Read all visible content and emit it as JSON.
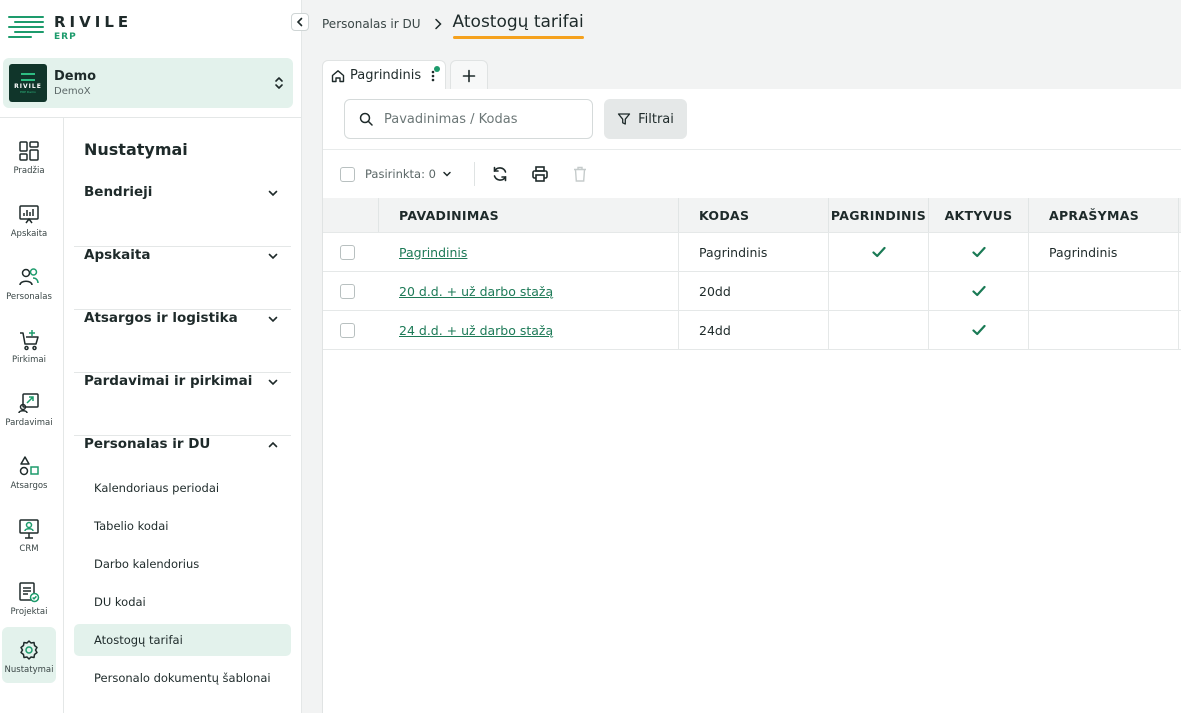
{
  "app": {
    "brand": "RIVILE",
    "product": "ERP"
  },
  "company": {
    "name": "Demo",
    "code": "DemoX",
    "logo_text": "RIVILE",
    "logo_sub": "ERP Demo"
  },
  "rail": [
    {
      "label": "Pradžia",
      "icon": "dashboard-icon"
    },
    {
      "label": "Apskaita",
      "icon": "accounting-icon"
    },
    {
      "label": "Personalas",
      "icon": "people-icon"
    },
    {
      "label": "Pirkimai",
      "icon": "cart-icon"
    },
    {
      "label": "Pardavimai",
      "icon": "sales-icon"
    },
    {
      "label": "Atsargos",
      "icon": "shapes-icon"
    },
    {
      "label": "CRM",
      "icon": "crm-icon"
    },
    {
      "label": "Projektai",
      "icon": "projects-icon"
    },
    {
      "label": "Nustatymai",
      "icon": "settings-icon",
      "active": true
    }
  ],
  "settings": {
    "title": "Nustatymai",
    "sections": [
      {
        "label": "Bendrieji",
        "expanded": false
      },
      {
        "label": "Apskaita",
        "expanded": false
      },
      {
        "label": "Atsargos ir logistika",
        "expanded": false
      },
      {
        "label": "Pardavimai ir pirkimai",
        "expanded": false
      },
      {
        "label": "Personalas ir DU",
        "expanded": true
      }
    ],
    "subitems": [
      {
        "label": "Kalendoriaus periodai"
      },
      {
        "label": "Tabelio kodai"
      },
      {
        "label": "Darbo kalendorius"
      },
      {
        "label": "DU kodai"
      },
      {
        "label": "Atostogų tarifai",
        "active": true
      },
      {
        "label": "Personalo dokumentų šablonai"
      }
    ]
  },
  "breadcrumb": {
    "parent": "Personalas ir DU",
    "current": "Atostogų tarifai"
  },
  "tabs": [
    {
      "label": "Pagrindinis"
    }
  ],
  "search": {
    "placeholder": "Pavadinimas / Kodas",
    "value": ""
  },
  "filter": {
    "label": "Filtrai"
  },
  "toolbar": {
    "selected_label": "Pasirinkta: 0"
  },
  "table": {
    "headers": {
      "name": "PAVADINIMAS",
      "code": "KODAS",
      "main": "PAGRINDINIS",
      "active": "AKTYVUS",
      "desc": "APRAŠYMAS"
    },
    "rows": [
      {
        "name": "Pagrindinis",
        "code": "Pagrindinis",
        "main": true,
        "active": true,
        "desc": "Pagrindinis"
      },
      {
        "name": "20 d.d. + už darbo stažą",
        "code": "20dd",
        "main": false,
        "active": true,
        "desc": ""
      },
      {
        "name": "24 d.d. + už darbo stažą",
        "code": "24dd",
        "main": false,
        "active": true,
        "desc": ""
      }
    ]
  },
  "colors": {
    "accent": "#1d9b6c",
    "highlight": "#e3f2ec",
    "underline": "#f5a11d"
  }
}
